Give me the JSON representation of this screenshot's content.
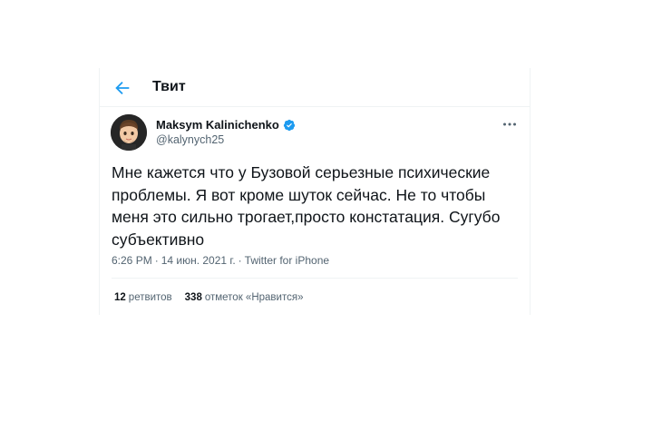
{
  "header": {
    "back_icon": "arrow-left-icon",
    "title": "Твит"
  },
  "author": {
    "name": "Maksym Kalinichenko",
    "handle": "@kalynych25",
    "verified_icon": "verified-badge-icon",
    "more_icon": "more-horizontal-icon"
  },
  "tweet": {
    "text": "Мне кажется что у Бузовой серьезные психические проблемы. Я вот кроме шуток сейчас. Не то чтобы меня это сильно трогает,просто констатация. Сугубо субъективно",
    "time": "6:26 PM",
    "dot": "·",
    "date": "14 июн. 2021 г.",
    "source": "Twitter for iPhone"
  },
  "stats": {
    "retweets_count": "12",
    "retweets_label": "ретвитов",
    "likes_count": "338",
    "likes_label": "отметок «Нравится»"
  },
  "colors": {
    "accent": "#1d9bf0",
    "text": "#0f1419",
    "secondary": "#536471",
    "border": "#eff3f4"
  }
}
